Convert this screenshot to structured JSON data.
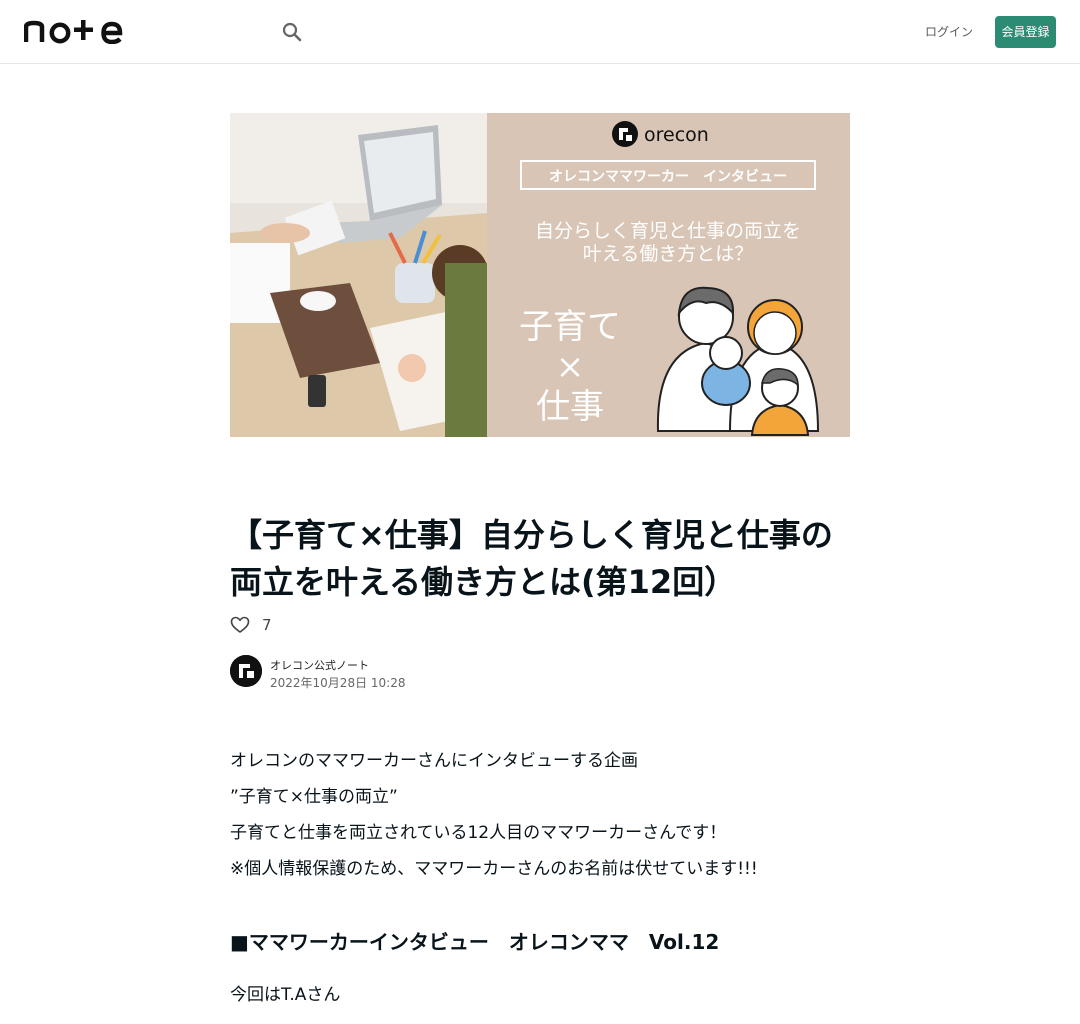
{
  "header": {
    "logo_text": "note",
    "login_label": "ログイン",
    "signup_label": "会員登録"
  },
  "hero": {
    "brand": "orecon",
    "banner_title": "オレコンママワーカー　インタビュー",
    "tagline_line1": "自分らしく育児と仕事の両立を",
    "tagline_line2": "叶える働き方とは？",
    "handwritten_line1": "子育て",
    "handwritten_line2": "×",
    "handwritten_line3": "仕事"
  },
  "article": {
    "title": "【子育て×仕事】自分らしく育児と仕事の両立を叶える働き方とは(第12回）",
    "like_count": "7",
    "author": "オレコン公式ノート",
    "date": "2022年10月28日 10:28",
    "body": [
      "オレコンのママワーカーさんにインタビューする企画",
      "”子育て×仕事の両立”",
      "子育てと仕事を両立されている12人目のママワーカーさんです！",
      "※個人情報保護のため、ママワーカーさんのお名前は伏せています!!!"
    ],
    "section_heading_jp": "■ママワーカーインタビュー　オレコンママ",
    "section_heading_vol": "Vol.12",
    "next_line": "今回はT.Aさん"
  },
  "colors": {
    "brand_green": "#2b8c73",
    "banner_bg": "#d8c5b6",
    "text": "#08131a"
  },
  "icons": [
    "search-icon",
    "heart-icon",
    "avatar-logo-icon",
    "orecon-logo-icon"
  ]
}
